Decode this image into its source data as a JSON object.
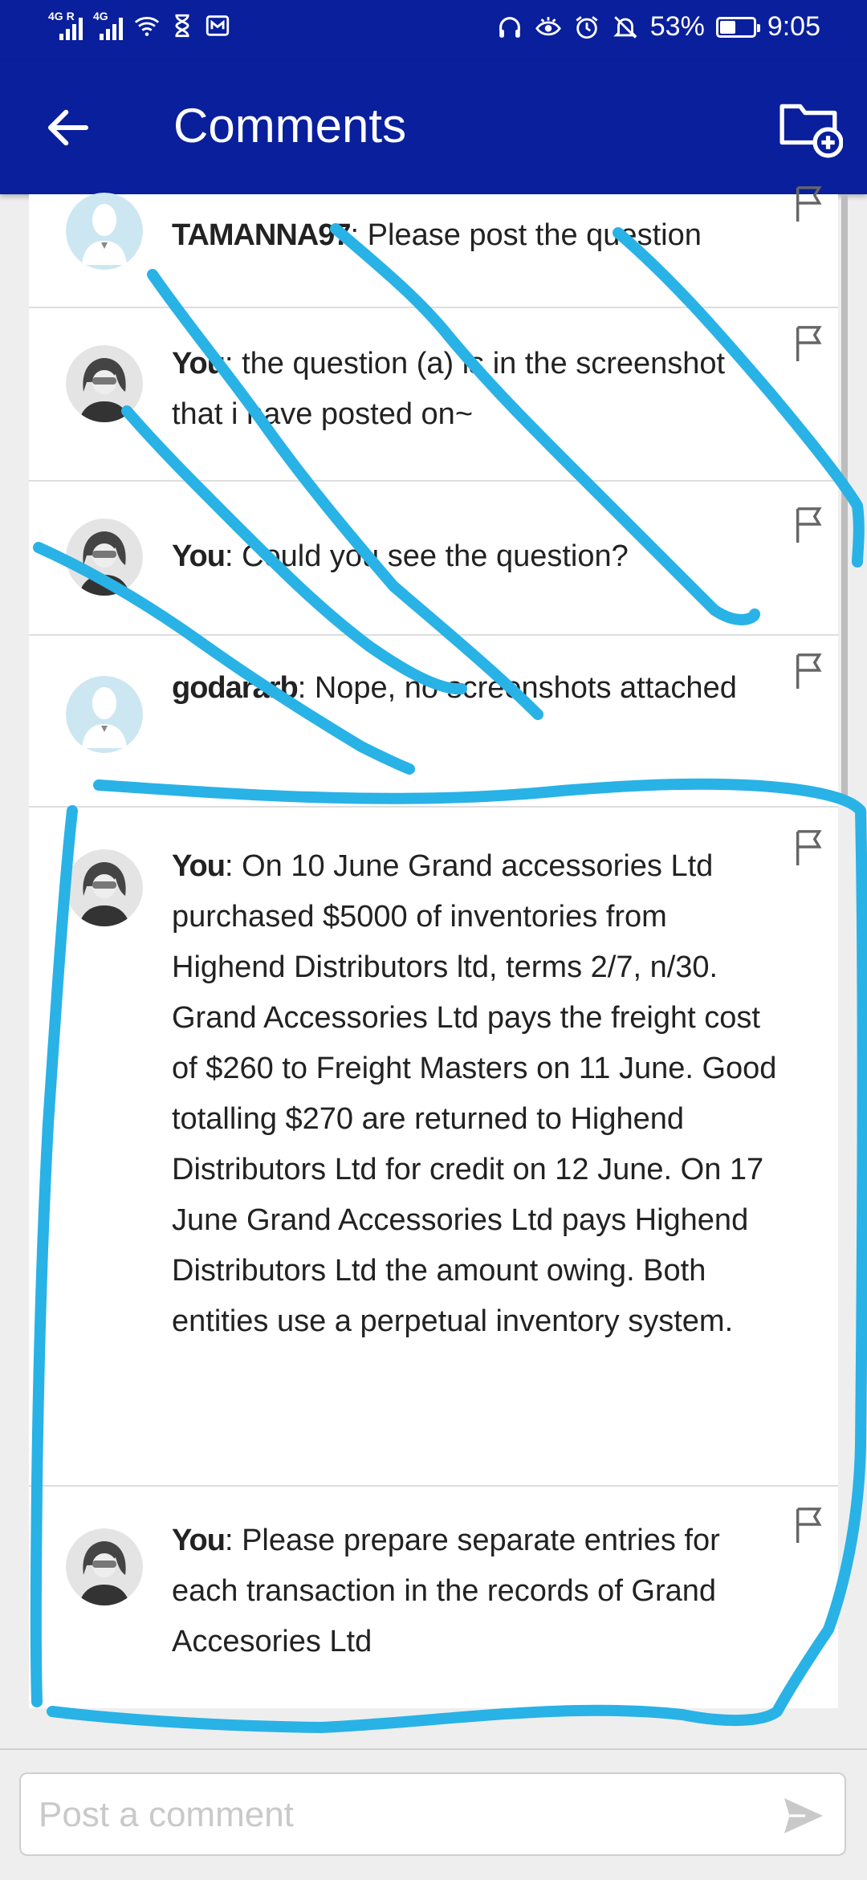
{
  "status_bar": {
    "network1": "4G R",
    "network2": "4G",
    "battery_percent": "53%",
    "battery_level": 0.53,
    "time": "9:05",
    "icons": [
      "signal-icon",
      "wifi-icon",
      "hourglass-icon",
      "mail-icon",
      "headphones-icon",
      "eye-icon",
      "alarm-icon",
      "bell-off-icon",
      "battery-icon"
    ]
  },
  "header": {
    "title": "Comments"
  },
  "comments": [
    {
      "author": "TAMANNA97",
      "separator": ": ",
      "text": "Please post the question",
      "avatar": "default"
    },
    {
      "author": "You",
      "separator": ": ",
      "text": "the question (a) is in the screenshot that i have posted on~",
      "avatar": "user"
    },
    {
      "author": "You",
      "separator": ": ",
      "text": "Could you see the question?",
      "avatar": "user"
    },
    {
      "author": "godararb",
      "separator": ": ",
      "text": "Nope, no screenshots attached",
      "avatar": "default"
    },
    {
      "author": "You",
      "separator": ": ",
      "text": "On 10 June Grand accessories Ltd purchased $5000 of inventories from Highend Distributors ltd, terms 2/7, n/30. Grand Accessories Ltd pays the freight cost of $260 to Freight Masters on 11 June. Good totalling $270 are returned to Highend Distributors Ltd for credit on 12 June. On 17 June Grand Accessories Ltd pays Highend Distributors Ltd the amount owing. Both entities use a perpetual inventory system.",
      "avatar": "user"
    },
    {
      "author": "You",
      "separator": ": ",
      "text": "Please prepare separate entries for each transaction in the records of Grand Accesories Ltd",
      "avatar": "user"
    }
  ],
  "composer": {
    "placeholder": "Post a comment"
  },
  "colors": {
    "appbar": "#0a1f9b",
    "scribble": "#29b2e6",
    "background": "#eeeeee"
  }
}
